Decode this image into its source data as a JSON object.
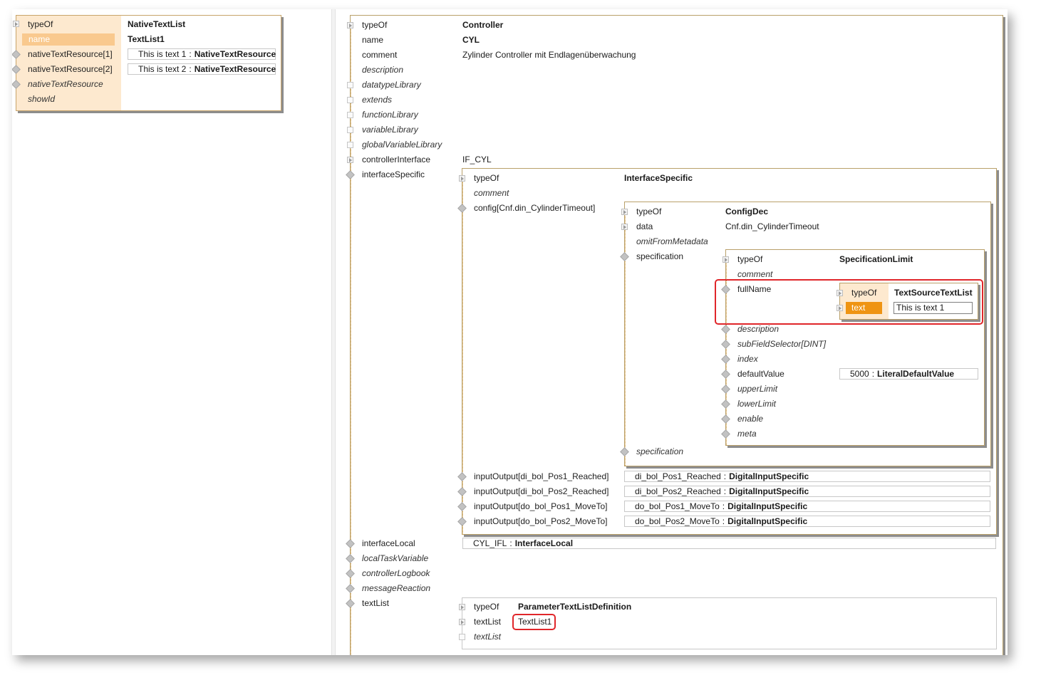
{
  "left_panel": {
    "rows": [
      {
        "key": "typeOf",
        "value": "NativeTextList"
      },
      {
        "key": "name",
        "value": "TextList1"
      },
      {
        "key": "nativeTextResource[1]",
        "ref_text": "This is text 1",
        "ref_type": "NativeTextResource"
      },
      {
        "key": "nativeTextResource[2]",
        "ref_text": "This is text 2",
        "ref_type": "NativeTextResource"
      },
      {
        "key": "nativeTextResource"
      },
      {
        "key": "showId"
      }
    ]
  },
  "main": {
    "typeOf": {
      "key": "typeOf",
      "value": "Controller"
    },
    "name": {
      "key": "name",
      "value": "CYL"
    },
    "comment": {
      "key": "comment",
      "value": "Zylinder Controller mit Endlagenüberwachung"
    },
    "description": "description",
    "datatypeLibrary": "datatypeLibrary",
    "extends": "extends",
    "functionLibrary": "functionLibrary",
    "variableLibrary": "variableLibrary",
    "globalVariableLibrary": "globalVariableLibrary",
    "controllerInterface": {
      "key": "controllerInterface",
      "value": "IF_CYL"
    },
    "interfaceSpecific": "interfaceSpecific",
    "interfaceLocal": {
      "key": "interfaceLocal",
      "ref_text": "CYL_IFL",
      "ref_type": "InterfaceLocal"
    },
    "localTaskVariable": "localTaskVariable",
    "controllerLogbook": "controllerLogbook",
    "messageReaction": "messageReaction",
    "textList": "textList"
  },
  "interface_specific": {
    "typeOf": {
      "key": "typeOf",
      "value": "InterfaceSpecific"
    },
    "comment": "comment",
    "config_key": "config[Cnf.din_CylinderTimeout]",
    "inputOutputs": [
      {
        "key": "inputOutput[di_bol_Pos1_Reached]",
        "ref_text": "di_bol_Pos1_Reached",
        "ref_type": "DigitalInputSpecific"
      },
      {
        "key": "inputOutput[di_bol_Pos2_Reached]",
        "ref_text": "di_bol_Pos2_Reached",
        "ref_type": "DigitalInputSpecific"
      },
      {
        "key": "inputOutput[do_bol_Pos1_MoveTo]",
        "ref_text": "do_bol_Pos1_MoveTo",
        "ref_type": "DigitalInputSpecific"
      },
      {
        "key": "inputOutput[do_bol_Pos2_MoveTo]",
        "ref_text": "do_bol_Pos2_MoveTo",
        "ref_type": "DigitalInputSpecific"
      }
    ]
  },
  "config": {
    "typeOf": {
      "key": "typeOf",
      "value": "ConfigDec"
    },
    "data": {
      "key": "data",
      "value": "Cnf.din_CylinderTimeout"
    },
    "omitFromMetadata": "omitFromMetadata",
    "specification": "specification",
    "specification2": "specification"
  },
  "spec_limit": {
    "typeOf": {
      "key": "typeOf",
      "value": "SpecificationLimit"
    },
    "comment": "comment",
    "fullName": "fullName",
    "description": "description",
    "subFieldSelector": "subFieldSelector[DINT]",
    "index": "index",
    "defaultValue": {
      "key": "defaultValue",
      "ref_text": "5000",
      "ref_type": "LiteralDefaultValue"
    },
    "upperLimit": "upperLimit",
    "lowerLimit": "lowerLimit",
    "enable": "enable",
    "meta": "meta"
  },
  "text_source": {
    "typeOf": {
      "key": "typeOf",
      "value": "TextSourceTextList"
    },
    "text": {
      "key": "text",
      "value": "This is text 1"
    }
  },
  "text_list_def": {
    "typeOf": {
      "key": "typeOf",
      "value": "ParameterTextListDefinition"
    },
    "textList": {
      "key": "textList",
      "value": "TextList1"
    },
    "textList2": "textList"
  },
  "cut_text": "textList",
  "colors": {
    "label_bg": "#fde9cf",
    "selected_light": "#f9c98e",
    "selected_dark": "#ef9413",
    "highlight": "#e0262a",
    "panel_border": "#b9a06a"
  },
  "icons": [
    "expand-triangle-icon",
    "diamond-icon",
    "empty-box-icon"
  ]
}
